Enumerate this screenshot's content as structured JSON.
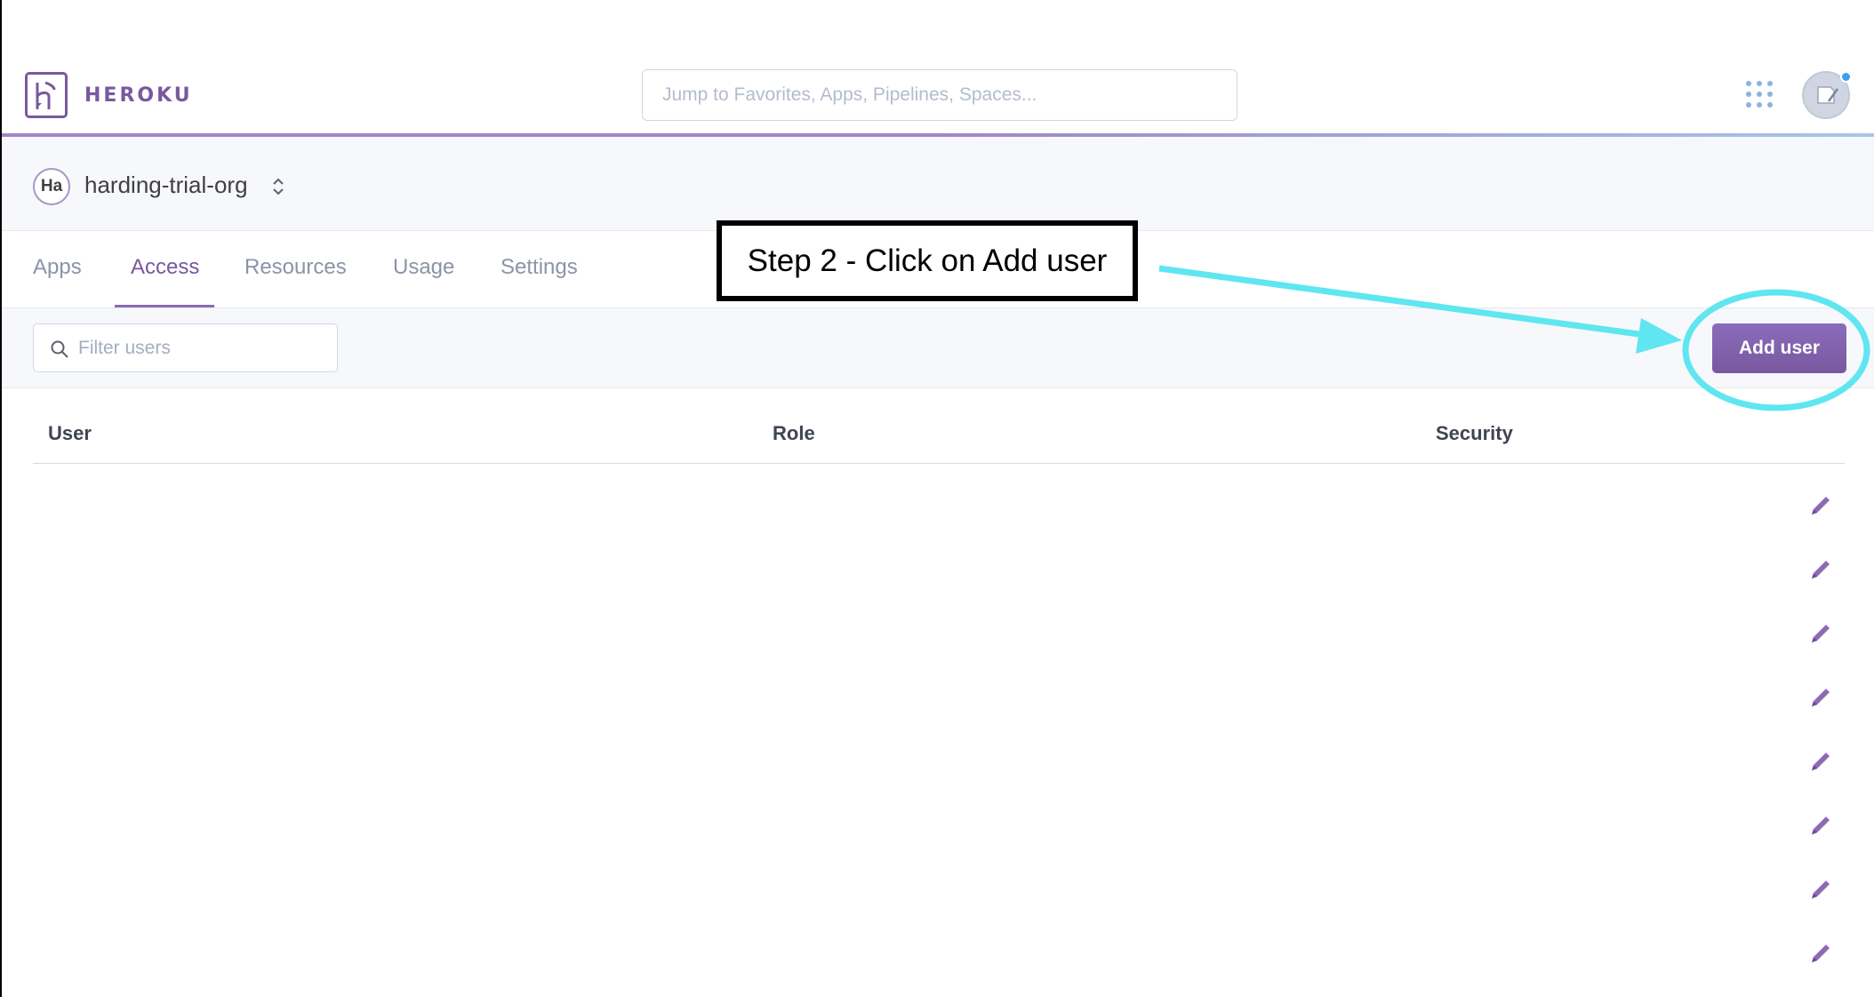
{
  "header": {
    "logo_text": "HEROKU",
    "search_placeholder": "Jump to Favorites, Apps, Pipelines, Spaces..."
  },
  "org": {
    "badge": "Ha",
    "name": "harding-trial-org"
  },
  "tabs": [
    {
      "label": "Apps",
      "active": false
    },
    {
      "label": "Access",
      "active": true
    },
    {
      "label": "Resources",
      "active": false
    },
    {
      "label": "Usage",
      "active": false
    },
    {
      "label": "Settings",
      "active": false
    }
  ],
  "toolbar": {
    "filter_placeholder": "Filter users",
    "add_user_label": "Add user"
  },
  "table": {
    "columns": [
      "User",
      "Role",
      "Security"
    ],
    "row_count": 8
  },
  "annotation": {
    "text": "Step 2 - Click on Add user"
  },
  "colors": {
    "brand": "#79589f",
    "highlight": "#5fe6f0"
  }
}
